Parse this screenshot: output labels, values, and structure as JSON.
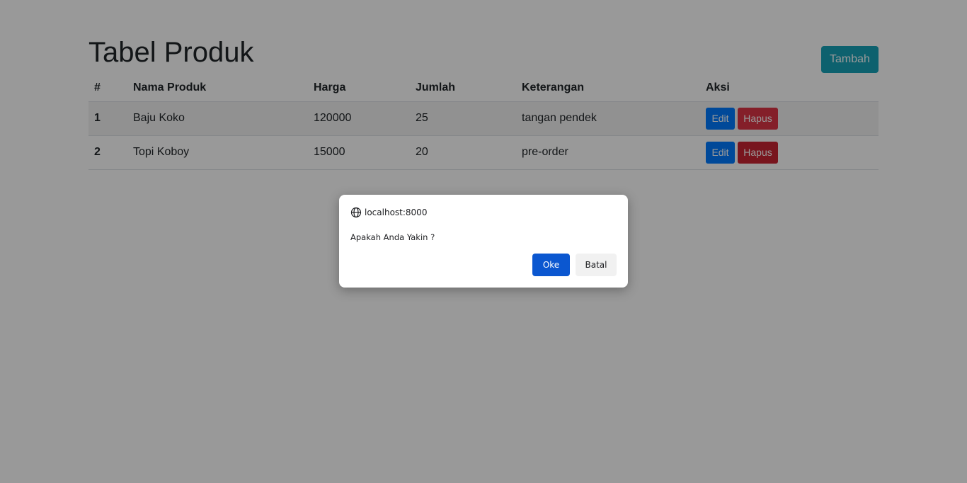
{
  "page": {
    "title": "Tabel Produk",
    "add_label": "Tambah"
  },
  "table": {
    "headers": [
      "#",
      "Nama Produk",
      "Harga",
      "Jumlah",
      "Keterangan",
      "Aksi"
    ],
    "rows": [
      {
        "num": "1",
        "name": "Baju Koko",
        "price": "120000",
        "qty": "25",
        "desc": "tangan pendek",
        "edit": "Edit",
        "delete": "Hapus"
      },
      {
        "num": "2",
        "name": "Topi Koboy",
        "price": "15000",
        "qty": "20",
        "desc": "pre-order",
        "edit": "Edit",
        "delete": "Hapus"
      }
    ]
  },
  "dialog": {
    "origin": "localhost:8000",
    "message": "Apakah Anda Yakin ?",
    "ok_label": "Oke",
    "cancel_label": "Batal",
    "icon": "globe-icon"
  },
  "colors": {
    "info": "#17a2b8",
    "primary": "#007bff",
    "danger": "#dc3545",
    "dialog_ok": "#0b57d0"
  }
}
